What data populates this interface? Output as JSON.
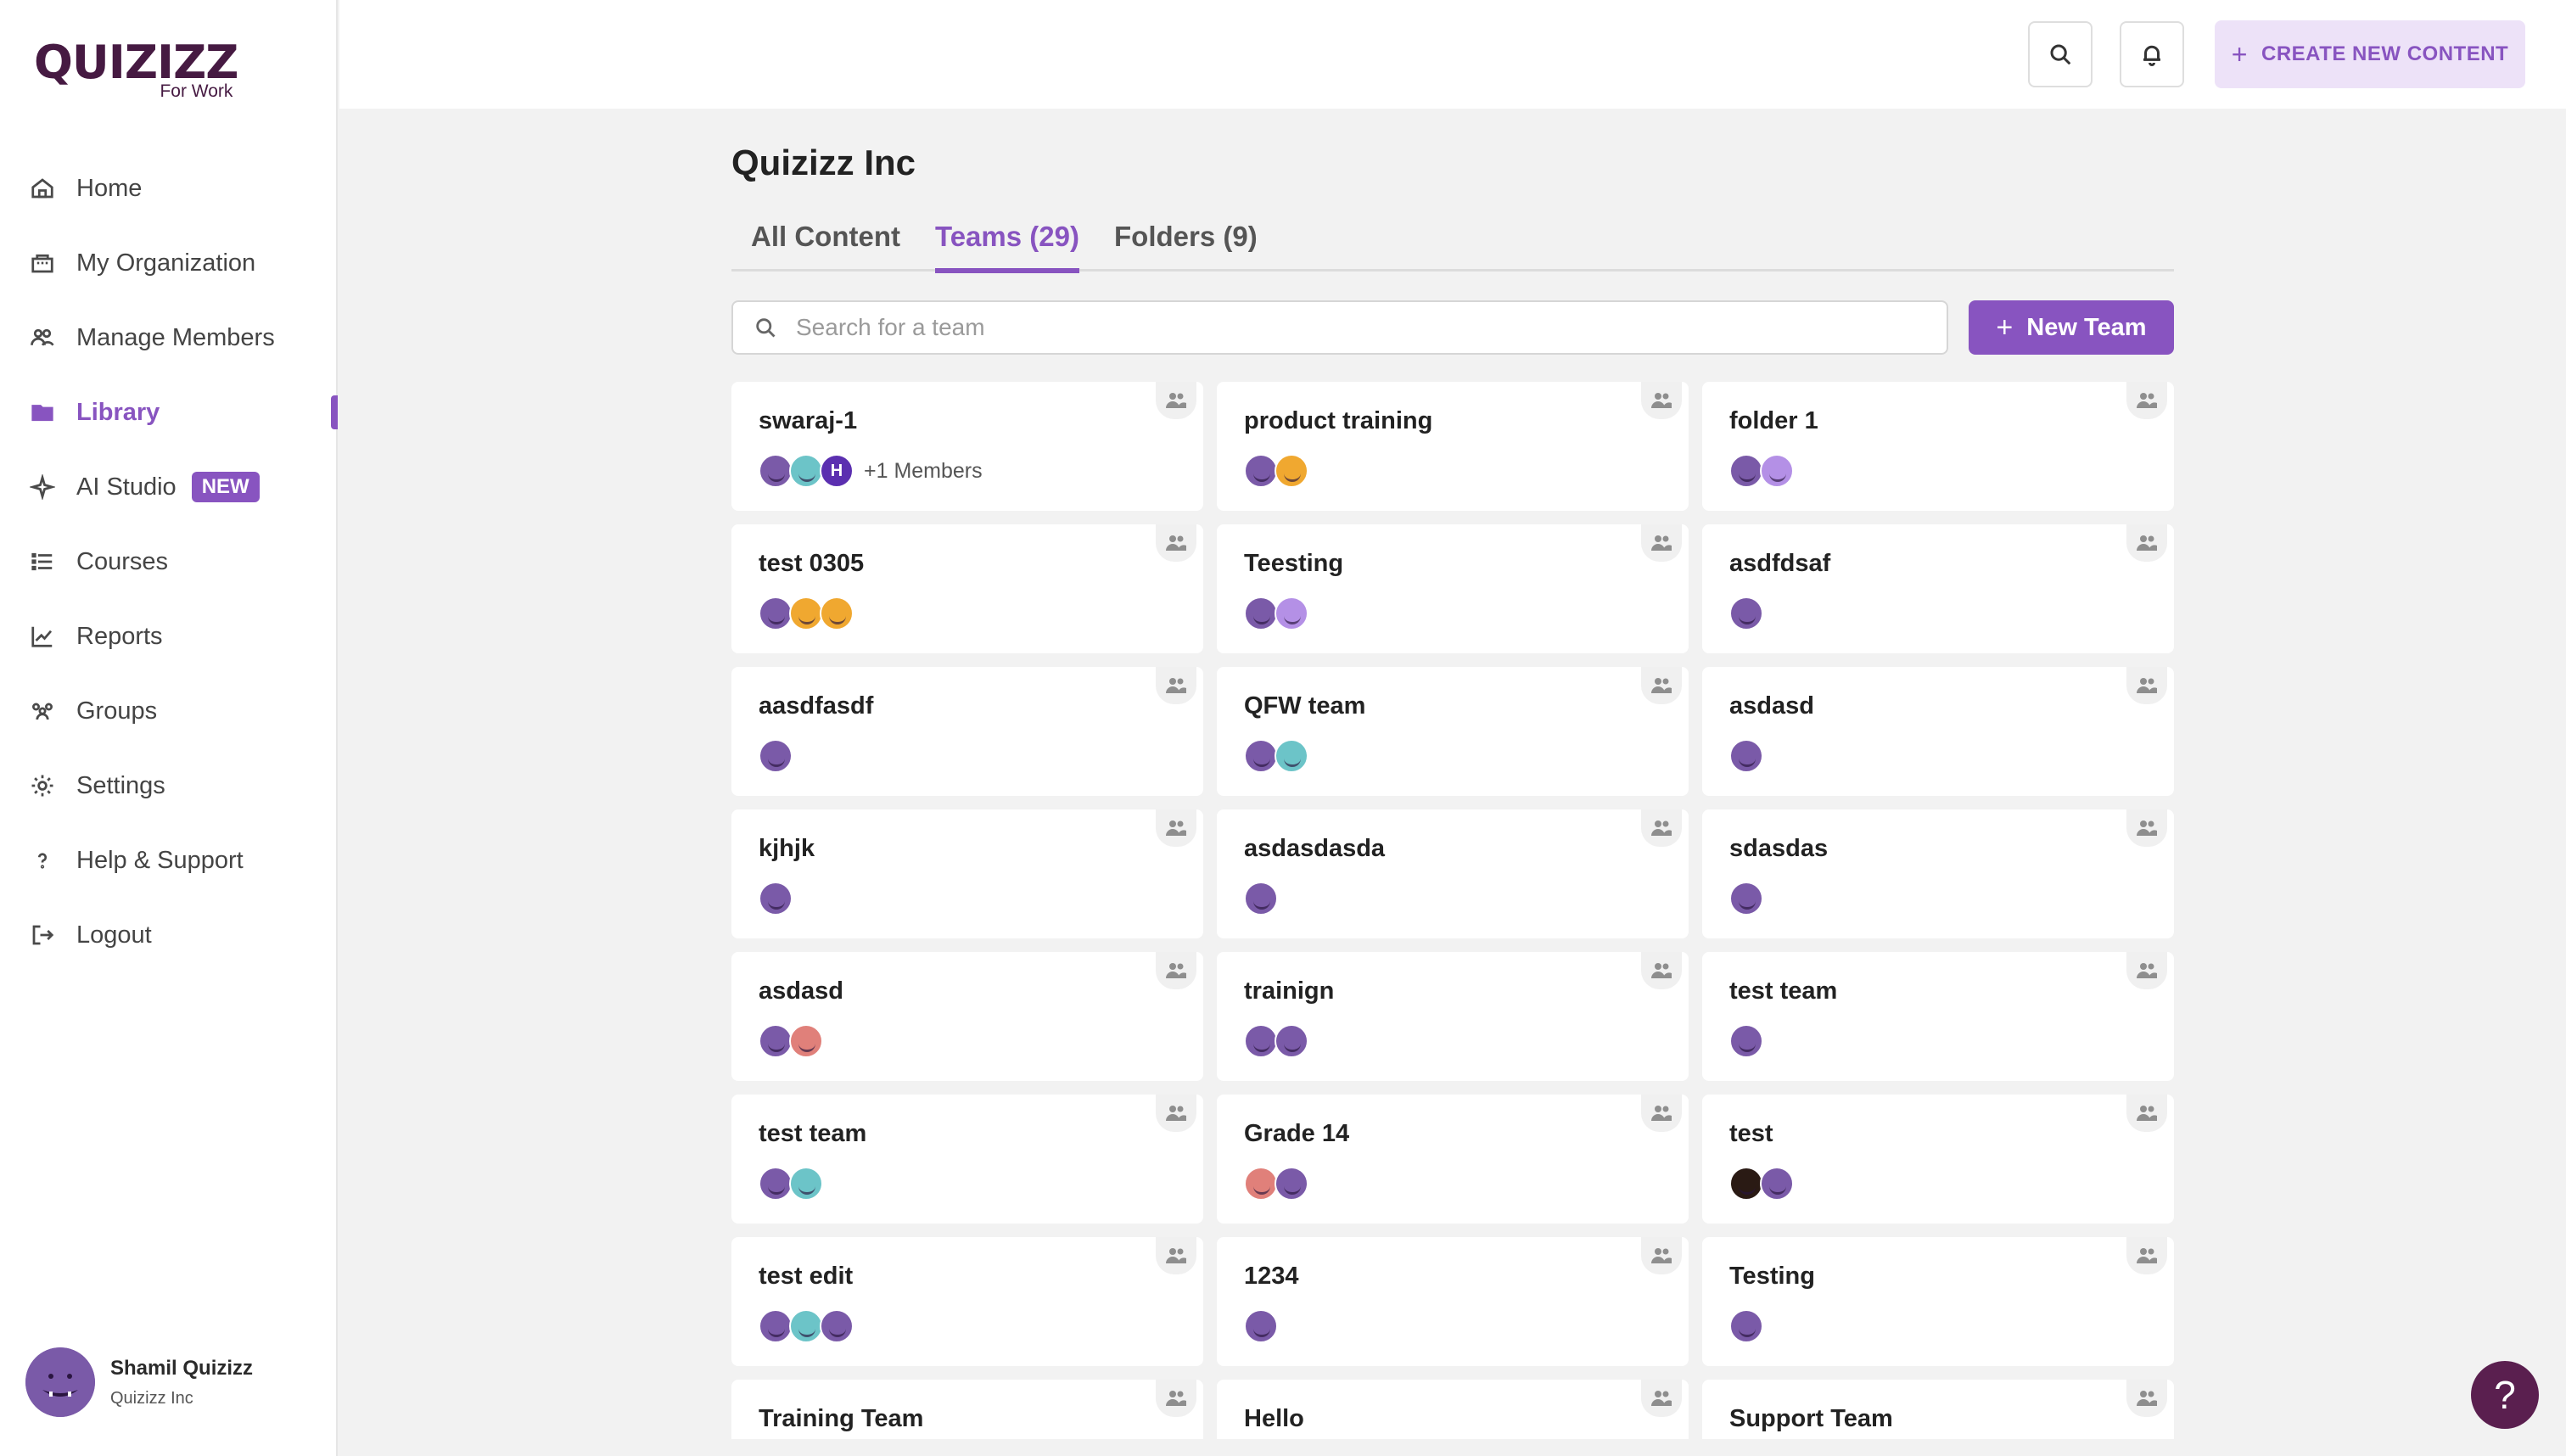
{
  "brand": {
    "name": "QUIZIZZ",
    "sub": "For Work"
  },
  "nav": [
    {
      "label": "Home",
      "icon": "home-icon"
    },
    {
      "label": "My Organization",
      "icon": "organization-icon"
    },
    {
      "label": "Manage Members",
      "icon": "members-icon"
    },
    {
      "label": "Library",
      "icon": "folder-icon",
      "active": true
    },
    {
      "label": "AI Studio",
      "icon": "sparkle-icon",
      "badge": "NEW"
    },
    {
      "label": "Courses",
      "icon": "courses-icon"
    },
    {
      "label": "Reports",
      "icon": "chart-icon"
    },
    {
      "label": "Groups",
      "icon": "groups-icon"
    },
    {
      "label": "Settings",
      "icon": "gear-icon"
    },
    {
      "label": "Help & Support",
      "icon": "question-icon"
    },
    {
      "label": "Logout",
      "icon": "logout-icon"
    }
  ],
  "profile": {
    "name": "Shamil Quizizz",
    "org": "Quizizz Inc"
  },
  "topbar": {
    "create_label": "CREATE NEW CONTENT"
  },
  "page": {
    "title": "Quizizz Inc"
  },
  "tabs": [
    {
      "label": "All Content"
    },
    {
      "label": "Teams (29)",
      "active": true
    },
    {
      "label": "Folders (9)"
    }
  ],
  "search": {
    "placeholder": "Search for a team",
    "value": ""
  },
  "new_team_label": "New Team",
  "colors": {
    "accent": "#8854c0",
    "avatar_purple": "#7a5aa8",
    "avatar_orange": "#f0a830",
    "avatar_lavender": "#b490e6",
    "avatar_pink": "#e0807a",
    "avatar_teal": "#6cc4c8",
    "avatar_dark": "#2a1a14",
    "avatar_indigo": "#5b2fb0"
  },
  "teams": [
    {
      "name": "swaraj-1",
      "avatars": [
        "purple",
        "teal",
        "letter:H"
      ],
      "extra": "+1 Members"
    },
    {
      "name": "product training",
      "avatars": [
        "purple",
        "orange"
      ]
    },
    {
      "name": "folder 1",
      "avatars": [
        "purple",
        "lavender"
      ]
    },
    {
      "name": "test 0305",
      "avatars": [
        "purple",
        "orange",
        "orange"
      ]
    },
    {
      "name": "Teesting",
      "avatars": [
        "purple",
        "lavender"
      ]
    },
    {
      "name": "asdfdsaf",
      "avatars": [
        "purple"
      ]
    },
    {
      "name": "aasdfasdf",
      "avatars": [
        "purple"
      ]
    },
    {
      "name": "QFW team",
      "avatars": [
        "purple",
        "teal"
      ]
    },
    {
      "name": "asdasd",
      "avatars": [
        "purple"
      ]
    },
    {
      "name": "kjhjk",
      "avatars": [
        "purple"
      ]
    },
    {
      "name": "asdasdasda",
      "avatars": [
        "purple"
      ]
    },
    {
      "name": "sdasdas",
      "avatars": [
        "purple"
      ]
    },
    {
      "name": "asdasd",
      "avatars": [
        "purple",
        "pink"
      ]
    },
    {
      "name": "trainign",
      "avatars": [
        "purple",
        "purple"
      ]
    },
    {
      "name": "test team",
      "avatars": [
        "purple"
      ]
    },
    {
      "name": "test team",
      "avatars": [
        "purple",
        "teal"
      ]
    },
    {
      "name": "Grade 14",
      "avatars": [
        "pink",
        "purple"
      ]
    },
    {
      "name": "test",
      "avatars": [
        "dark",
        "purple"
      ]
    },
    {
      "name": "test edit",
      "avatars": [
        "purple",
        "teal",
        "purple"
      ]
    },
    {
      "name": "1234",
      "avatars": [
        "purple"
      ]
    },
    {
      "name": "Testing",
      "avatars": [
        "purple"
      ]
    },
    {
      "name": "Training Team",
      "avatars": [
        "purple"
      ]
    },
    {
      "name": "Hello",
      "avatars": [
        "purple"
      ]
    },
    {
      "name": "Support Team",
      "avatars": [
        "purple"
      ]
    }
  ],
  "help_label": "?"
}
